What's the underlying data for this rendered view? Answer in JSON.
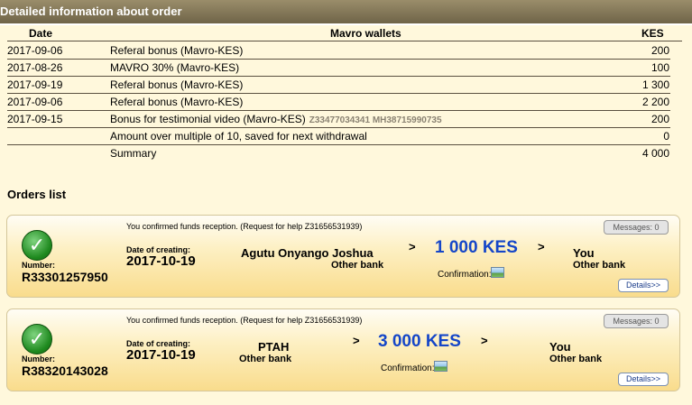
{
  "header": {
    "title": "Detailed information about order"
  },
  "table": {
    "col_date": "Date",
    "col_wallet": "Mavro wallets",
    "col_amount": "KES",
    "rows": [
      {
        "date": "2017-09-06",
        "desc": "Referal bonus (Mavro-KES)",
        "amount": "200"
      },
      {
        "date": "2017-08-26",
        "desc": "MAVRO 30% (Mavro-KES)",
        "amount": "100"
      },
      {
        "date": "2017-09-19",
        "desc": "Referal bonus (Mavro-KES)",
        "amount": "1 300"
      },
      {
        "date": "2017-09-06",
        "desc": "Referal bonus (Mavro-KES)",
        "amount": "2 200"
      },
      {
        "date": "2017-09-15",
        "desc": "Bonus for testimonial video (Mavro-KES)",
        "extra": "Z33477034341 MH38715990735",
        "amount": "200"
      }
    ],
    "remainder": {
      "desc": "Amount over multiple of 10, saved for next withdrawal",
      "amount": "0"
    },
    "summary": {
      "desc": "Summary",
      "amount": "4 000"
    }
  },
  "orders_title": "Orders list",
  "orders": [
    {
      "status": "You confirmed funds reception. (Request for help Z31656531939)",
      "messages": "Messages: 0",
      "number_label": "Number:",
      "number": "R33301257950",
      "date_label": "Date of creating:",
      "date": "2017-10-19",
      "sender": "Agutu Onyango Joshua",
      "sender_bank": "Other bank",
      "amount": "1 000 KES",
      "confirmation": "Confirmation:",
      "receiver": "You",
      "receiver_bank": "Other bank",
      "details": "Details>>",
      "arrow": ">",
      "check_icon": "check-icon"
    },
    {
      "status": "You confirmed funds reception. (Request for help Z31656531939)",
      "messages": "Messages: 0",
      "number_label": "Number:",
      "number": "R38320143028",
      "date_label": "Date of creating:",
      "date": "2017-10-19",
      "sender": "PTAH",
      "sender_bank": "Other bank",
      "amount": "3 000 KES",
      "confirmation": "Confirmation:",
      "receiver": "You",
      "receiver_bank": "Other bank",
      "details": "Details>>",
      "arrow": ">",
      "check_icon": "check-icon"
    }
  ],
  "colors": {
    "accent_amount": "#1546c8",
    "header_bar": "#7d7255",
    "card_gold": "#f9dc8c"
  }
}
